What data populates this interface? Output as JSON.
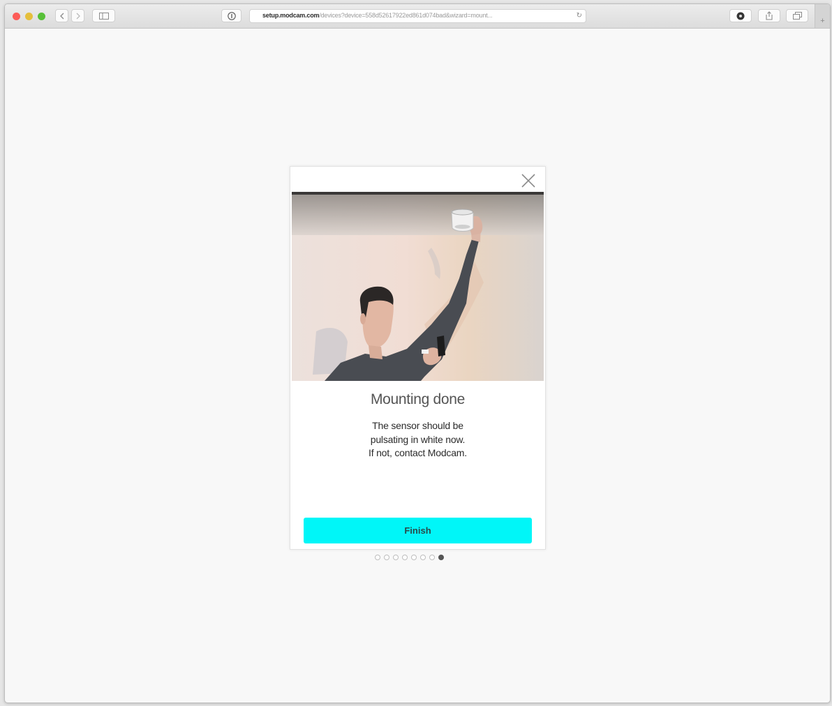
{
  "browser": {
    "url_host": "setup.modcam.com",
    "url_path": "/devices?device=558d52617922ed861d074bad&wizard=mount..."
  },
  "modal": {
    "title": "Mounting done",
    "description_lines": [
      "The sensor should be",
      "pulsating in white now.",
      "If not, contact Modcam."
    ],
    "finish_label": "Finish"
  },
  "pagination": {
    "total_steps": 8,
    "current_step": 8
  },
  "colors": {
    "button": "#00f6f8",
    "traffic_red": "#fc5b57",
    "traffic_yellow": "#e5bf3c",
    "traffic_green": "#57c038"
  }
}
